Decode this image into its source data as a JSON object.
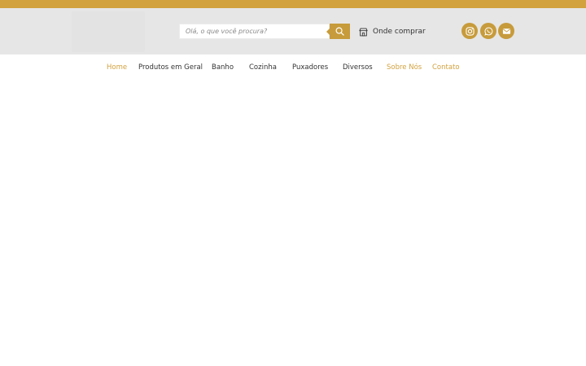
{
  "colors": {
    "brand": "#d2a23f",
    "button": "#c79b3b",
    "header_bg": "#e6e6e6"
  },
  "search": {
    "placeholder": "Olá, o que você procura?",
    "button_icon": "search-icon"
  },
  "store_link": {
    "icon": "shop-icon",
    "label": "Onde comprar"
  },
  "social": [
    {
      "icon": "instagram-icon"
    },
    {
      "icon": "whatsapp-icon"
    },
    {
      "icon": "envelope-icon"
    }
  ],
  "nav": {
    "items": [
      {
        "label": "Home",
        "active": true
      },
      {
        "label": "Produtos em Geral"
      },
      {
        "label": "Banho"
      },
      {
        "label": "Cozinha"
      },
      {
        "label": "Puxadores"
      },
      {
        "label": "Diversos"
      },
      {
        "label": "Sobre Nós",
        "active": true
      },
      {
        "label": "Contato",
        "active": true
      }
    ]
  }
}
